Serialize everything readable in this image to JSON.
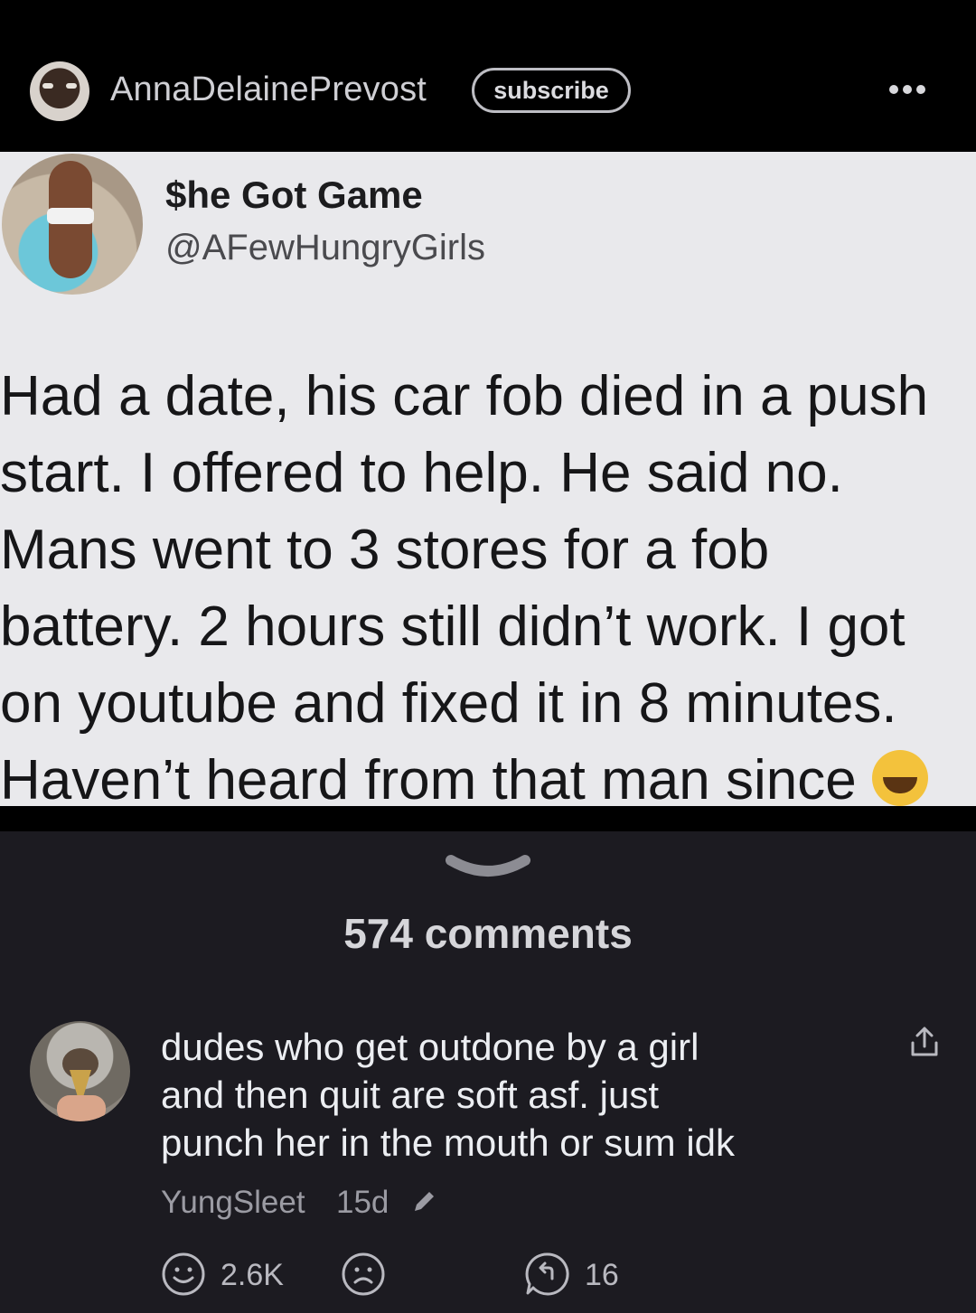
{
  "header": {
    "author": "AnnaDelainePrevost",
    "subscribe_label": "subscribe",
    "more_icon": "more-horizontal-icon"
  },
  "tweet": {
    "display_name": "$he Got Game",
    "handle": "@AFewHungryGirls",
    "text": "Had a date, his car fob died in a push\nstart. I offered to help. He said no.\nMans went to 3 stores for a fob\nbattery. 2 hours still didn’t work. I got\non youtube and fixed it in 8 minutes.\nHaven’t heard from that man since",
    "emoji": "laughing-emoji"
  },
  "comments_section": {
    "count_label": "574 comments"
  },
  "comment": {
    "text": "dudes who get outdone by a girl\nand then quit are soft asf. just\npunch her in the mouth or sum idk",
    "username": "YungSleet",
    "age": "15d",
    "upvote_count": "2.6K",
    "reply_count": "16"
  },
  "colors": {
    "header_bg": "#000000",
    "page_bg": "#1c1b21",
    "tweet_bg": "#e9e9ec",
    "meta_text": "#9b9ba3"
  }
}
